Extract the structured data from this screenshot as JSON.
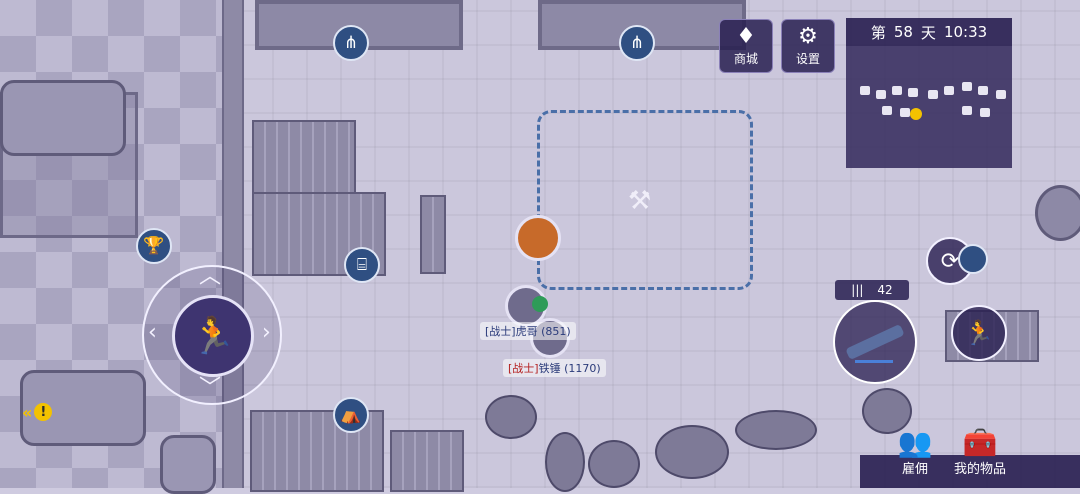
{
  "hud": {
    "shop_label": "商城",
    "settings_label": "设置",
    "day_prefix": "第",
    "day_number": "58",
    "day_suffix": "天",
    "time": "10:33",
    "ammo_count": "42",
    "ammo_icon": "|||",
    "hire_label": "雇佣",
    "inventory_label": "我的物品"
  },
  "players": [
    {
      "role": "[战士]",
      "name": "虎哥",
      "power": "(851)"
    },
    {
      "role": "[战士]",
      "name": "铁锤",
      "power": "(1170)"
    }
  ],
  "icons": {
    "shop": "diamond-icon",
    "settings": "gear-icon",
    "hammer": "build-hammer-icon",
    "trophy": "trophy-icon",
    "fence": "fence-icon",
    "tent": "tent-icon",
    "farm": "farm-plot-icon",
    "run": "run-icon",
    "reload": "reload-icon",
    "sprint": "sprint-icon",
    "hire": "hire-icon",
    "inventory": "chest-icon",
    "quest": "quest-warning-icon"
  },
  "colors": {
    "hud_bg": "#281e50",
    "map_icon": "#2f4f82",
    "build_zone": "#4a6fa8",
    "warning": "#f3c200",
    "role_red": "#b42020",
    "name_blue": "#2b3b7a"
  }
}
